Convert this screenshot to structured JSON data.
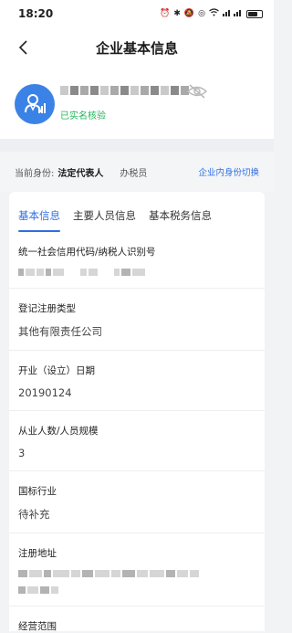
{
  "status_bar": {
    "time": "18:20",
    "icons": [
      "alarm-icon",
      "bluetooth-icon",
      "mute-icon",
      "hotspot-icon",
      "wifi-icon",
      "signal-icon",
      "battery-icon"
    ]
  },
  "nav": {
    "title": "企业基本信息"
  },
  "profile": {
    "verified_text": "已实名核验",
    "avatar_color": "#3b82e6"
  },
  "identity": {
    "label": "当前身份:",
    "active_role": "法定代表人",
    "other_role": "办税员",
    "switch_link": "企业内身份切换"
  },
  "tabs": [
    {
      "label": "基本信息",
      "active": true
    },
    {
      "label": "主要人员信息",
      "active": false
    },
    {
      "label": "基本税务信息",
      "active": false
    }
  ],
  "fields": [
    {
      "label": "统一社会信用代码/纳税人识别号",
      "value": ""
    },
    {
      "label": "登记注册类型",
      "value": "其他有限责任公司"
    },
    {
      "label": "开业（设立）日期",
      "value": "20190124"
    },
    {
      "label": "从业人数/人员规模",
      "value": "3"
    },
    {
      "label": "国标行业",
      "value": "待补充"
    },
    {
      "label": "注册地址",
      "value": ""
    },
    {
      "label": "经营范围",
      "value": ""
    }
  ],
  "colors": {
    "accent": "#2f6fe0",
    "verified": "#21b45a"
  }
}
